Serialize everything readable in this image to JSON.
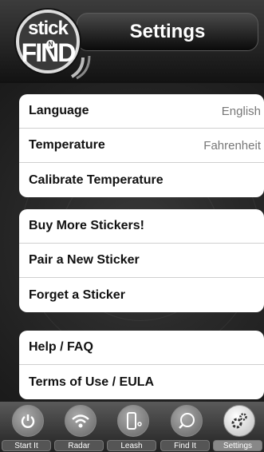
{
  "header": {
    "title": "Settings",
    "logo": {
      "line1": "stick",
      "small": "N",
      "line2": "FIND"
    }
  },
  "groups": [
    {
      "items": [
        {
          "label": "Language",
          "value": "English"
        },
        {
          "label": "Temperature",
          "value": "Fahrenheit"
        },
        {
          "label": "Calibrate Temperature",
          "value": ""
        }
      ]
    },
    {
      "items": [
        {
          "label": "Buy More Stickers!"
        },
        {
          "label": "Pair a New Sticker"
        },
        {
          "label": "Forget a Sticker"
        }
      ]
    },
    {
      "items": [
        {
          "label": "Help / FAQ"
        },
        {
          "label": "Terms of Use / EULA"
        }
      ]
    }
  ],
  "tabbar": {
    "active": "Settings",
    "tabs": [
      {
        "label": "Start It",
        "icon": "power-icon"
      },
      {
        "label": "Radar",
        "icon": "wifi-icon"
      },
      {
        "label": "Leash",
        "icon": "phone-leash-icon"
      },
      {
        "label": "Find It",
        "icon": "find-icon"
      },
      {
        "label": "Settings",
        "icon": "gears-icon"
      }
    ]
  }
}
